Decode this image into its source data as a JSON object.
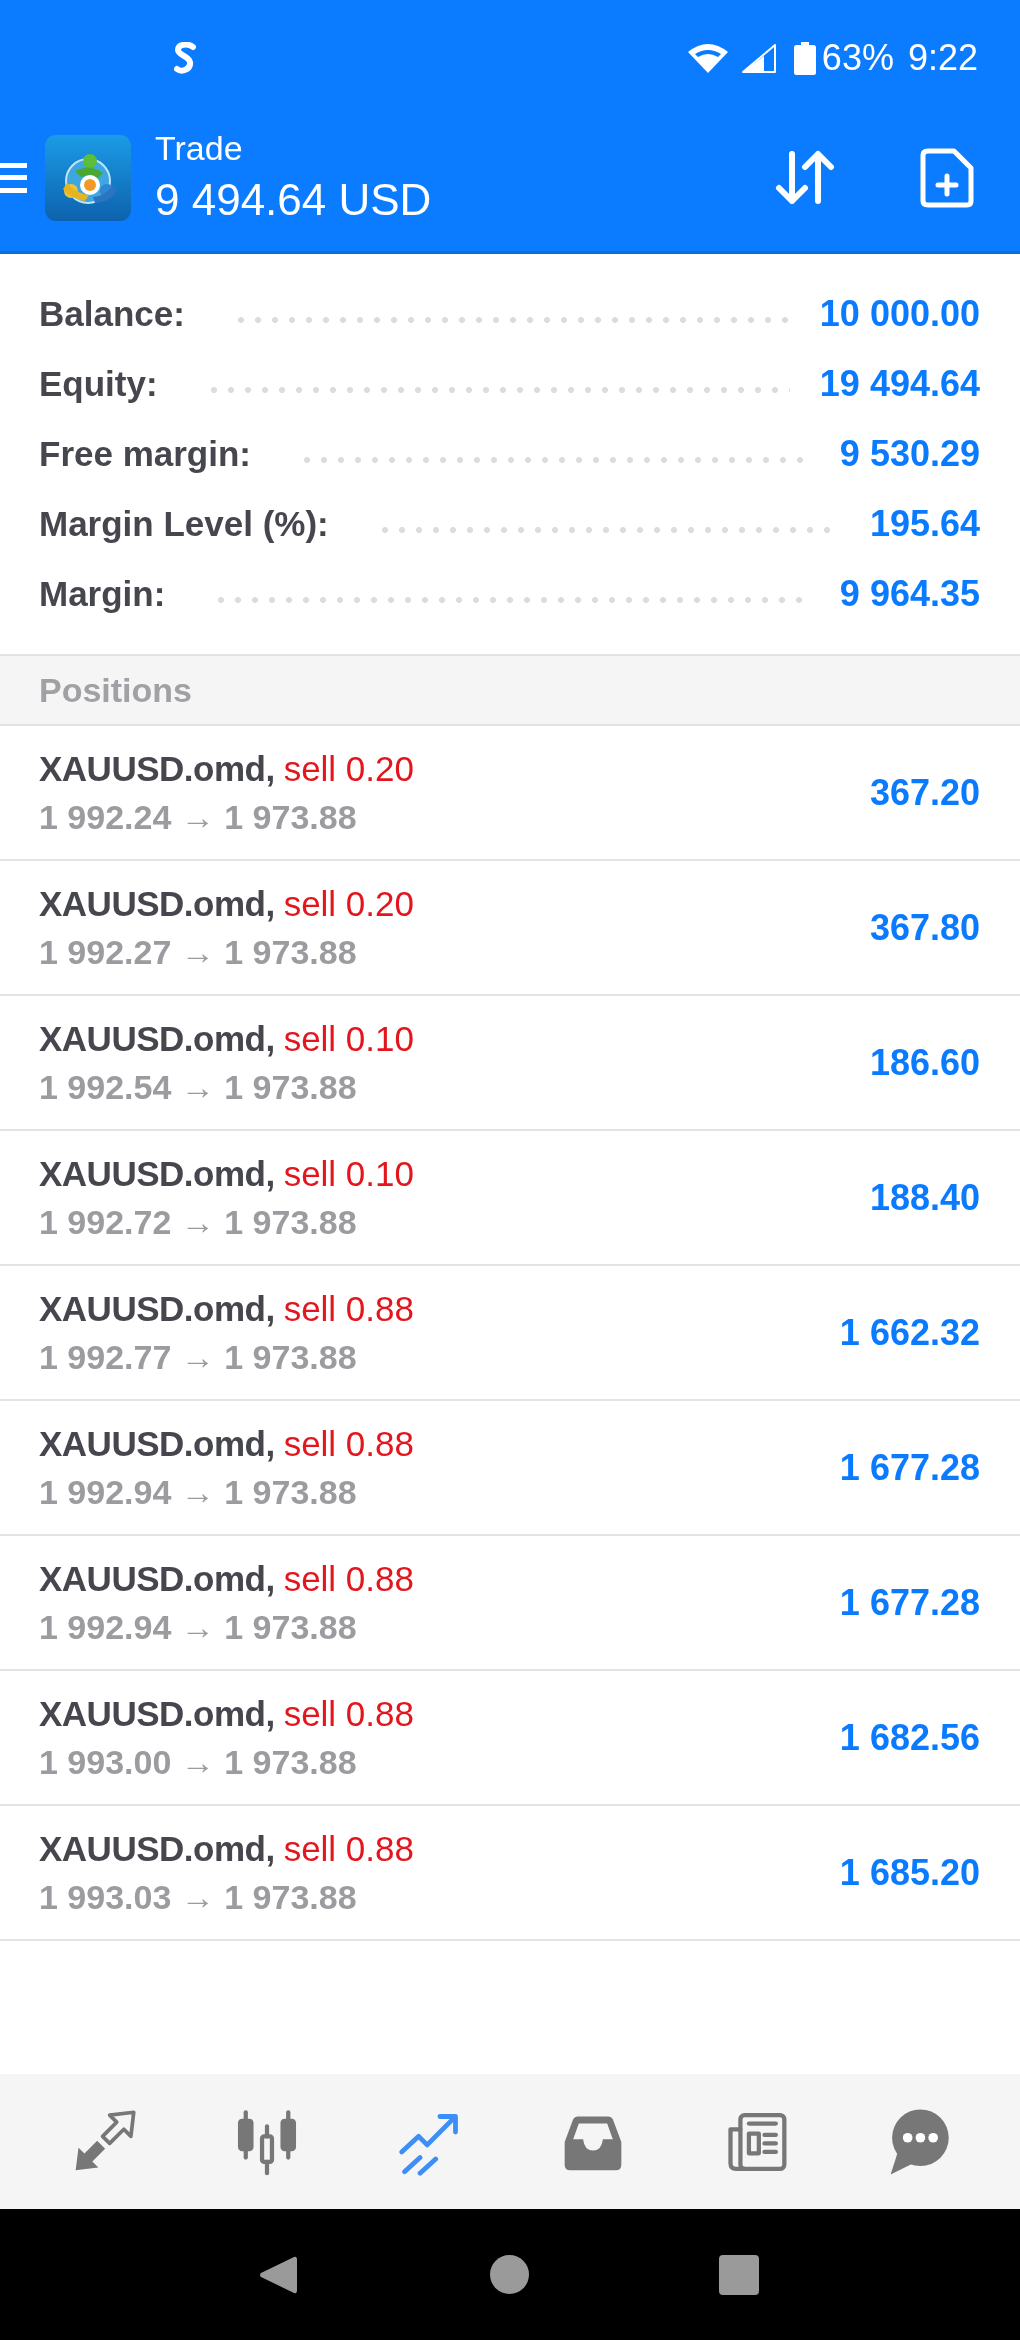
{
  "status_bar": {
    "battery": "63%",
    "time": "9:22"
  },
  "app_bar": {
    "title": "Trade",
    "balance": "9 494.64 USD"
  },
  "summary": [
    {
      "label": "Balance:",
      "value": "10 000.00"
    },
    {
      "label": "Equity:",
      "value": "19 494.64"
    },
    {
      "label": "Free margin:",
      "value": "9 530.29"
    },
    {
      "label": "Margin Level (%):",
      "value": "195.64"
    },
    {
      "label": "Margin:",
      "value": "9 964.35"
    }
  ],
  "positions": {
    "title": "Positions",
    "items": [
      {
        "symbol": "XAUUSD.omd,",
        "kind": "sell",
        "order": "sell 0.20",
        "prices": "1 992.24 → 1 973.88",
        "profit": "367.20"
      },
      {
        "symbol": "XAUUSD.omd,",
        "kind": "sell",
        "order": "sell 0.20",
        "prices": "1 992.27 → 1 973.88",
        "profit": "367.80"
      },
      {
        "symbol": "XAUUSD.omd,",
        "kind": "sell",
        "order": "sell 0.10",
        "prices": "1 992.54 → 1 973.88",
        "profit": "186.60"
      },
      {
        "symbol": "XAUUSD.omd,",
        "kind": "sell",
        "order": "sell 0.10",
        "prices": "1 992.72 → 1 973.88",
        "profit": "188.40"
      },
      {
        "symbol": "XAUUSD.omd,",
        "kind": "sell",
        "order": "sell 0.88",
        "prices": "1 992.77 → 1 973.88",
        "profit": "1 662.32"
      },
      {
        "symbol": "XAUUSD.omd,",
        "kind": "sell",
        "order": "sell 0.88",
        "prices": "1 992.94 → 1 973.88",
        "profit": "1 677.28"
      },
      {
        "symbol": "XAUUSD.omd,",
        "kind": "sell",
        "order": "sell 0.88",
        "prices": "1 992.94 → 1 973.88",
        "profit": "1 677.28"
      },
      {
        "symbol": "XAUUSD.omd,",
        "kind": "sell",
        "order": "sell 0.88",
        "prices": "1 993.00 → 1 973.88",
        "profit": "1 682.56"
      },
      {
        "symbol": "XAUUSD.omd,",
        "kind": "sell",
        "order": "sell 0.88",
        "prices": "1 993.03 → 1 973.88",
        "profit": "1 685.20"
      }
    ]
  },
  "bottom_nav": [
    {
      "kind": "quotes",
      "selected": false
    },
    {
      "kind": "chart",
      "selected": false
    },
    {
      "kind": "trade",
      "selected": true
    },
    {
      "kind": "history",
      "selected": false
    },
    {
      "kind": "news",
      "selected": false
    },
    {
      "kind": "messages",
      "selected": false
    }
  ]
}
